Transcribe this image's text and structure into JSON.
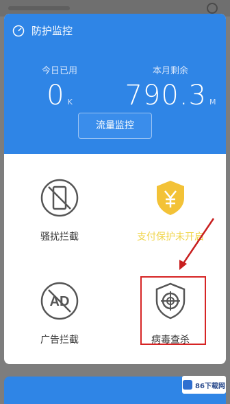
{
  "header": {
    "title": "防护监控",
    "today_label": "今日已用",
    "today_value": "0",
    "today_unit": "K",
    "month_label": "本月剩余",
    "month_value": "790.3",
    "month_unit": "M",
    "monitor_button": "流量监控"
  },
  "tiles": [
    {
      "label": "骚扰拦截",
      "icon": "no-phone-icon"
    },
    {
      "label": "支付保护未开启",
      "icon": "yen-shield-icon"
    },
    {
      "label": "广告拦截",
      "icon": "no-ad-icon"
    },
    {
      "label": "病毒查杀",
      "icon": "virus-target-shield-icon"
    }
  ],
  "colors": {
    "primary": "#2f85e6",
    "warning": "#f0c330",
    "highlight": "#d62424"
  },
  "watermark": "86下载网"
}
